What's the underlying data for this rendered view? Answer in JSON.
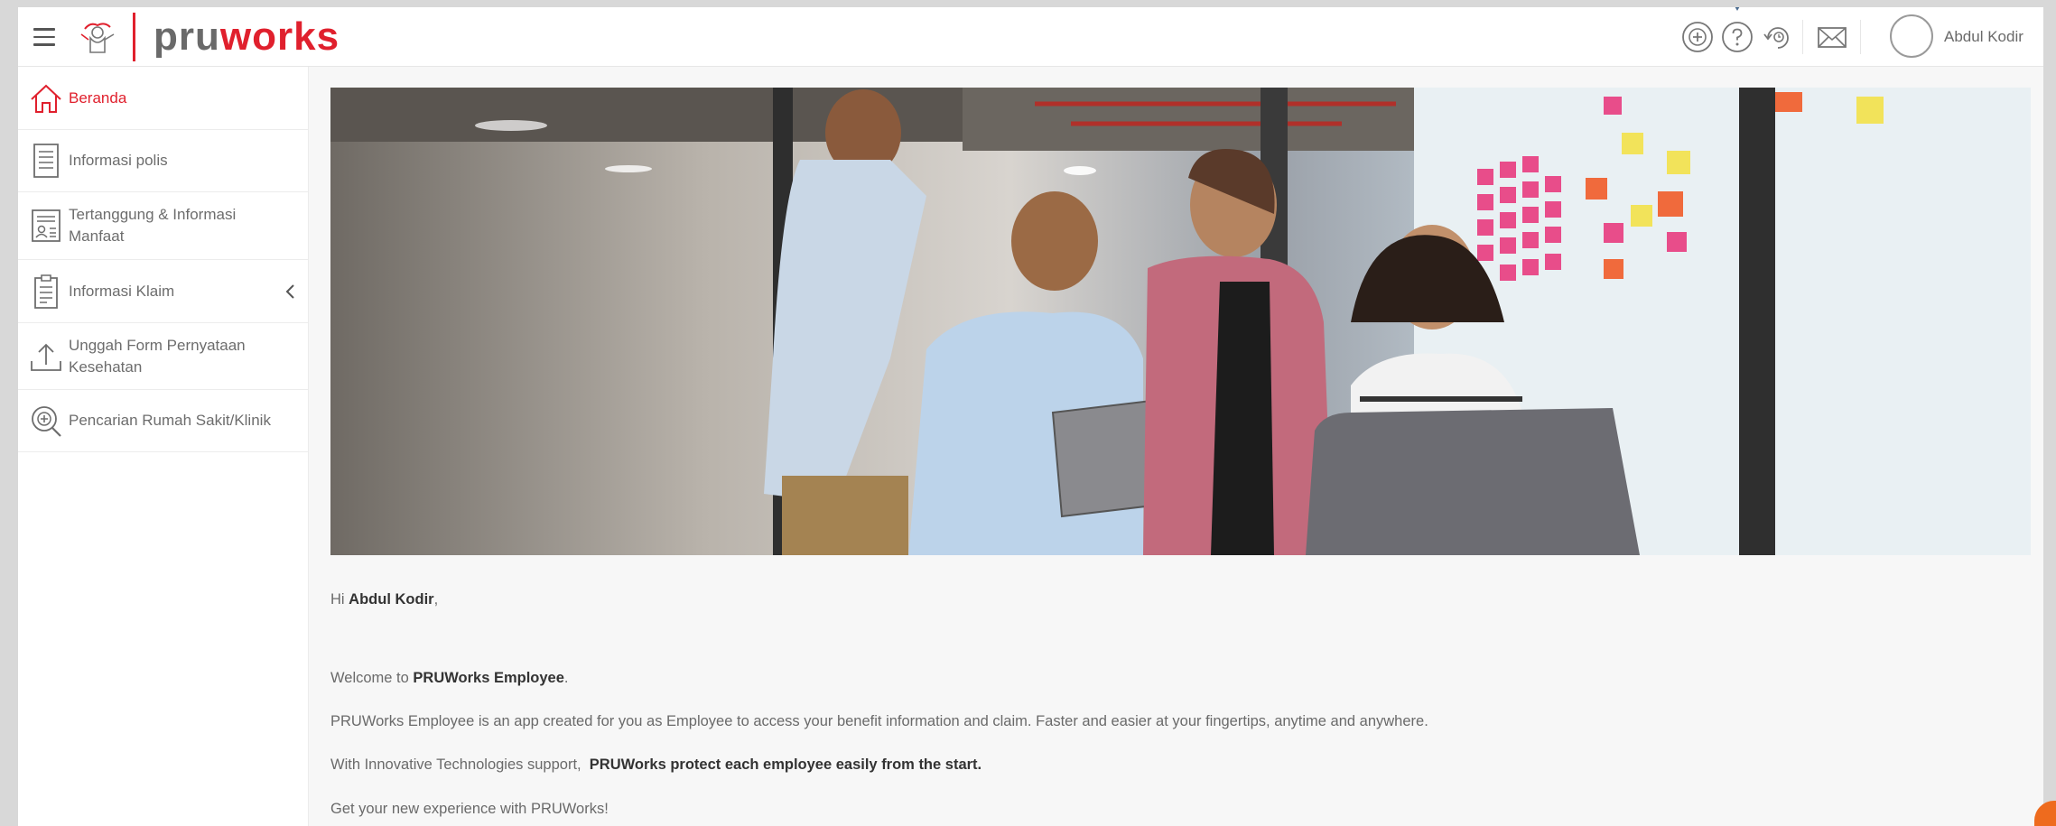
{
  "header": {
    "logo_text_part1": "pru",
    "logo_text_part2": "works",
    "user_name": "Abdul Kodir",
    "icons": [
      "add-circle-icon",
      "help-icon",
      "refresh-icon",
      "mail-icon"
    ]
  },
  "sidebar": {
    "items": [
      {
        "label": "Beranda",
        "icon": "home-icon",
        "active": true
      },
      {
        "label": "Informasi polis",
        "icon": "document-icon"
      },
      {
        "label_line1": "Tertanggung & Informasi",
        "label_line2": "Manfaat",
        "icon": "id-card-icon"
      },
      {
        "label": "Informasi Klaim",
        "icon": "clipboard-icon",
        "has_submenu": true
      },
      {
        "label_line1": "Unggah Form Pernyataan",
        "label_line2": "Kesehatan",
        "icon": "upload-icon"
      },
      {
        "label": "Pencarian Rumah Sakit/Klinik",
        "icon": "hospital-search-icon"
      }
    ]
  },
  "main": {
    "greeting_prefix": "Hi ",
    "greeting_name": "Abdul Kodir",
    "greeting_suffix": ",",
    "welcome_prefix": "Welcome to ",
    "welcome_bold": "PRUWorks Employee",
    "welcome_suffix": ".",
    "description": "PRUWorks Employee is an app created for you as Employee to access your benefit information and claim. Faster and easier at your fingertips,  anytime and anywhere.",
    "support_prefix": "With Innovative Technologies support,  ",
    "support_bold": "PRUWorks protect each employee easily from the start.",
    "cta": "Get your new experience  with PRUWorks!"
  },
  "colors": {
    "brand_red": "#e0202d",
    "text_gray": "#6a6a6a",
    "accent_orange": "#ee6b1e"
  }
}
